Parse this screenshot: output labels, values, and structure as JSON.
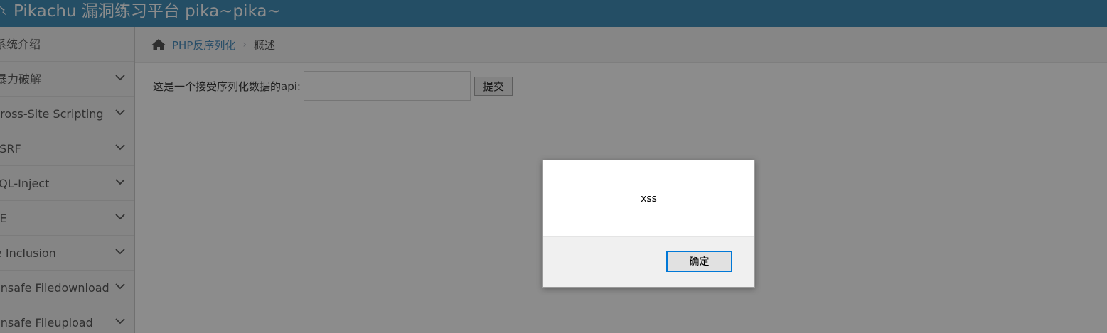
{
  "app": {
    "title": "Pikachu 漏洞练习平台 pika~pika~"
  },
  "sidebar": {
    "items": [
      {
        "label": "系统介绍",
        "has_submenu": false
      },
      {
        "label": "暴力破解",
        "has_submenu": true
      },
      {
        "label": "Cross-Site Scripting",
        "has_submenu": true
      },
      {
        "label": "CSRF",
        "has_submenu": true
      },
      {
        "label": "SQL-Inject",
        "has_submenu": true
      },
      {
        "label": "RCE",
        "has_submenu": true
      },
      {
        "label": "File Inclusion",
        "has_submenu": true
      },
      {
        "label": "Unsafe Filedownload",
        "has_submenu": true
      },
      {
        "label": "Unsafe Fileupload",
        "has_submenu": true
      }
    ]
  },
  "breadcrumb": {
    "section": "PHP反序列化",
    "current": "概述"
  },
  "form": {
    "label": "这是一个接受序列化数据的api:",
    "input_value": "",
    "submit_label": "提交"
  },
  "dialog": {
    "message": "xss",
    "ok_label": "确定"
  },
  "colors": {
    "navbar": "#438eb9",
    "link": "#4c8fbd",
    "dialog_focus": "#0078d7"
  },
  "icons": {
    "brand": "pikachu-logo-icon",
    "home": "home-icon",
    "chevron": "chevron-down-icon"
  }
}
